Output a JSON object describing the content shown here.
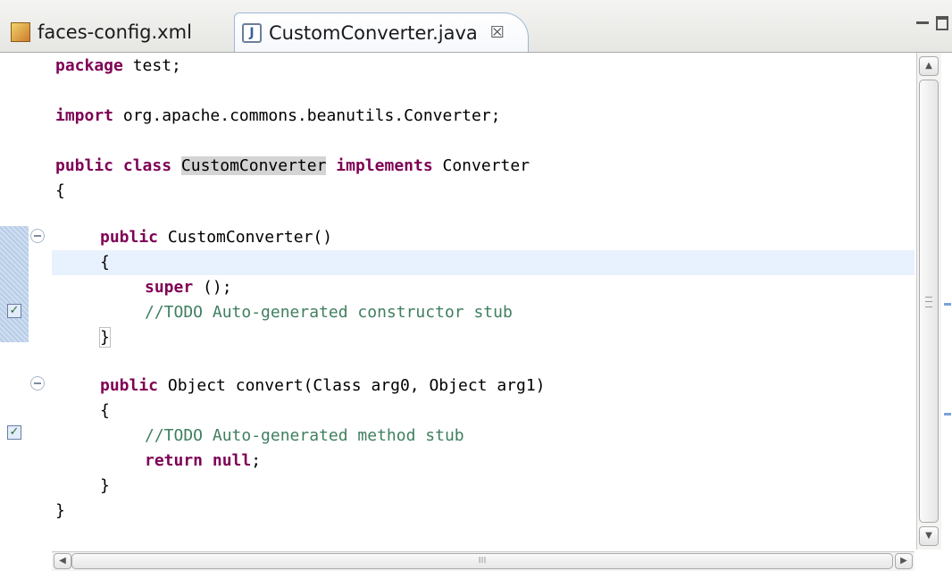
{
  "tabs": [
    {
      "label": "faces-config.xml",
      "icon": "xml-file-icon",
      "active": false
    },
    {
      "label": "CustomConverter.java",
      "icon": "java-file-icon",
      "active": true,
      "close_glyph": "☒"
    }
  ],
  "code": {
    "l1_kw": "package",
    "l1_rest": " test;",
    "l3_kw": "import",
    "l3_rest": " org.apache.commons.beanutils.Converter;",
    "l5_kw1": "public class",
    "l5_name": "CustomConverter",
    "l5_kw2": "implements",
    "l5_rest": " Converter",
    "l6": "{",
    "l8_kw": "public",
    "l8_rest": " CustomConverter()",
    "l9": "{",
    "l10_kw": "super",
    "l10_rest": " ();",
    "l11_comment": "//TODO Auto-generated constructor stub",
    "l12": "}",
    "l14_kw": "public",
    "l14_rest": " Object convert(Class arg0, Object arg1)",
    "l15": "{",
    "l16_comment": "//TODO Auto-generated method stub",
    "l17_kw1": "return",
    "l17_kw2": "null",
    "l17_rest": ";",
    "l18": "}",
    "l19": "}"
  },
  "scrollbar": {
    "up": "▲",
    "down": "▼",
    "left": "◀",
    "right": "▶",
    "grip": "III"
  },
  "colors": {
    "keyword": "#7f0055",
    "comment": "#3f7f5f",
    "current_line": "#e8f2fe"
  }
}
